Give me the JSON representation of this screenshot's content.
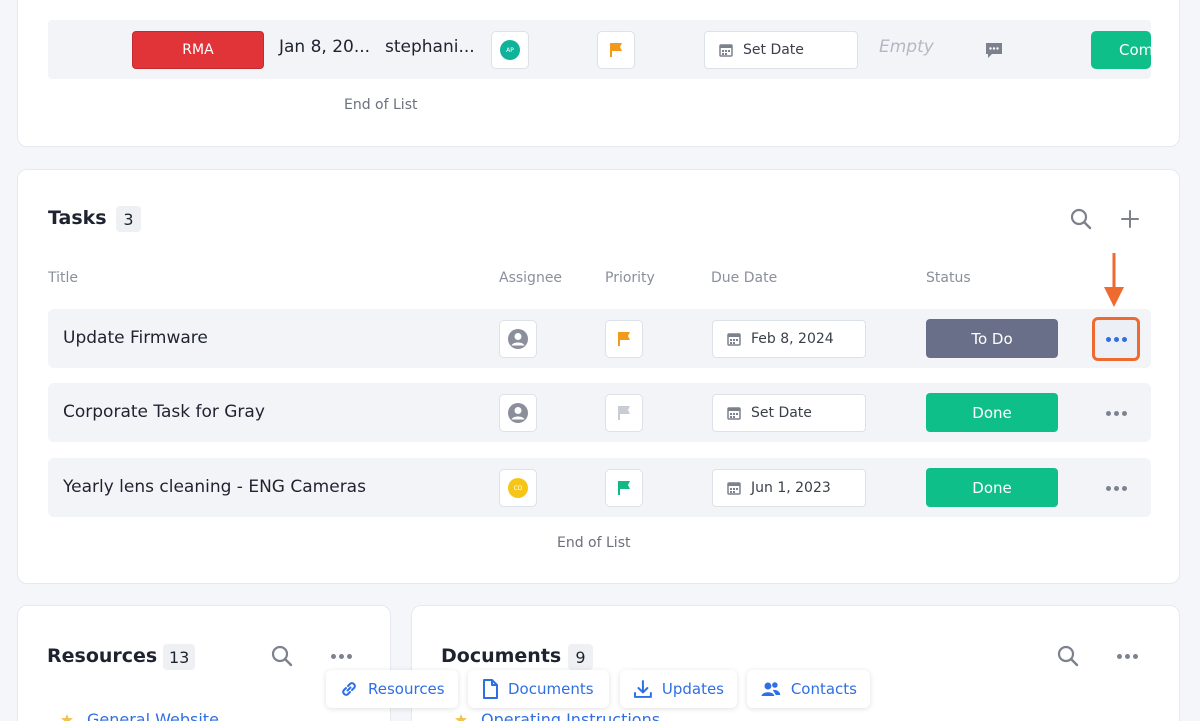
{
  "top_card": {
    "tag_label": "RMA",
    "date": "Jan 8, 20...",
    "user": "stephani...",
    "avatar_initials": "AP",
    "due_date_label": "Set Date",
    "empty_label": "Empty",
    "status_label": "Com",
    "end_of_list": "End of List"
  },
  "tasks": {
    "title": "Tasks",
    "count": "3",
    "columns": {
      "title": "Title",
      "assignee": "Assignee",
      "priority": "Priority",
      "due_date": "Due Date",
      "status": "Status"
    },
    "rows": [
      {
        "title": "Update Firmware",
        "due": "Feb 8, 2024",
        "status": "To Do",
        "priority_color": "#f29a1b",
        "assignee": "default-avatar-icon"
      },
      {
        "title": "Corporate Task for Gray",
        "due": "Set Date",
        "status": "Done",
        "priority_color": "#c9ccd4",
        "assignee": "default-avatar-icon"
      },
      {
        "title": "Yearly lens cleaning - ENG Cameras",
        "due": "Jun 1, 2023",
        "status": "Done",
        "priority_color": "#12b886",
        "assignee_initials": "CD"
      }
    ],
    "end_of_list": "End of List"
  },
  "resources": {
    "title": "Resources",
    "count": "13",
    "first_item": "General Website"
  },
  "documents": {
    "title": "Documents",
    "count": "9",
    "first_item": "Operating Instructions"
  },
  "bottom_nav": {
    "resources": "Resources",
    "documents": "Documents",
    "updates": "Updates",
    "contacts": "Contacts"
  },
  "colors": {
    "accent": "#2f6fe4",
    "danger": "#e03438",
    "success": "#0fbf8a",
    "todo": "#696f88",
    "highlight": "#ef6a2f"
  }
}
